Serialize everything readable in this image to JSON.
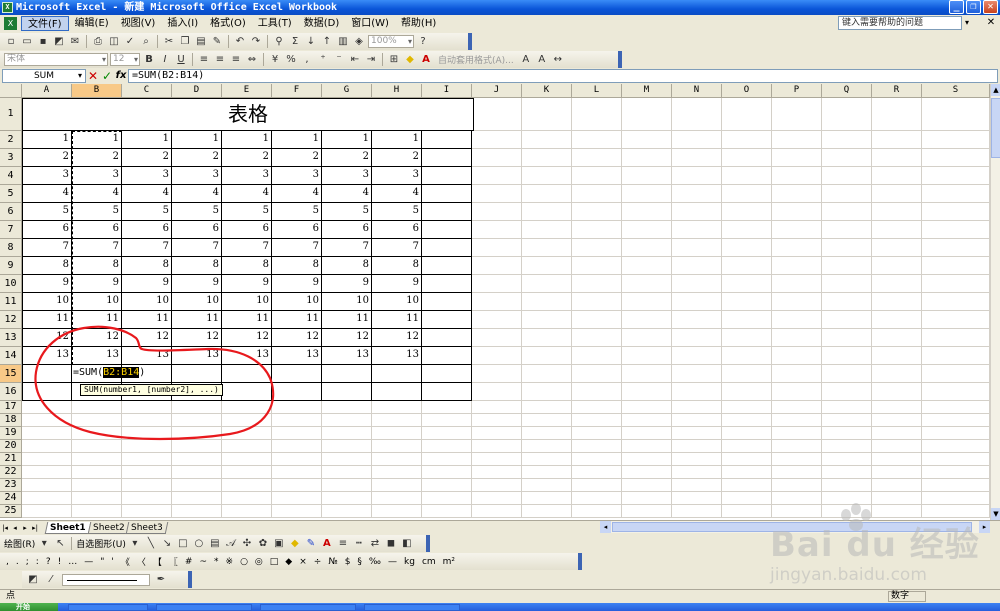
{
  "window": {
    "title": "Microsoft Excel - 新建 Microsoft Office Excel Workbook",
    "minimize": "_",
    "restore": "❐",
    "close": "✕"
  },
  "menu": {
    "items": [
      "文件(F)",
      "编辑(E)",
      "视图(V)",
      "插入(I)",
      "格式(O)",
      "工具(T)",
      "数据(D)",
      "窗口(W)",
      "帮助(H)"
    ],
    "help_placeholder": "键入需要帮助的问题"
  },
  "toolbar": {
    "zoom": "100%",
    "font_name": "宋体",
    "font_size": "12",
    "conditional_format": "自动套用格式(A)..."
  },
  "formula_bar": {
    "name_box": "SUM",
    "formula": "=SUM(B2:B14)"
  },
  "sheet": {
    "columns": [
      "A",
      "B",
      "C",
      "D",
      "E",
      "F",
      "G",
      "H",
      "I",
      "J",
      "K",
      "L",
      "M",
      "N",
      "O",
      "P",
      "Q",
      "R",
      "S"
    ],
    "rows": [
      "1",
      "2",
      "3",
      "4",
      "5",
      "6",
      "7",
      "8",
      "9",
      "10",
      "11",
      "12",
      "13",
      "14",
      "15",
      "16",
      "17",
      "18",
      "19",
      "20",
      "21",
      "22",
      "23",
      "24",
      "25"
    ],
    "title": "表格",
    "values": [
      1,
      2,
      3,
      4,
      5,
      6,
      7,
      8,
      9,
      10,
      11,
      12,
      13
    ],
    "edit_prefix": "=SUM(",
    "edit_ref": "B2:B14",
    "edit_suffix": ")",
    "tooltip": "SUM(number1, [number2], ...)",
    "selected_column": "B",
    "selected_row": "15"
  },
  "sheet_tabs": [
    "Sheet1",
    "Sheet2",
    "Sheet3"
  ],
  "drawing_toolbar": {
    "draw_label": "绘图(R)",
    "autoshapes_label": "自选图形(U)"
  },
  "symbols": [
    ",",
    ".",
    ";",
    ":",
    "?",
    "!",
    "…",
    "—",
    "\"",
    "'",
    "《",
    "〈",
    "【",
    "〖",
    "#",
    "~",
    "*",
    "※",
    "○",
    "◎",
    "□",
    "◆",
    "×",
    "÷",
    "№",
    "$",
    "§",
    "‰",
    "—",
    "kg",
    "cm",
    "m²"
  ],
  "status": {
    "mode": "点",
    "num": "数字"
  },
  "taskbar": {
    "start": "开始"
  },
  "watermark": {
    "brand": "Bai du 经验",
    "url": "jingyan.baidu.com"
  },
  "colors": {
    "annotation": "#e8191d",
    "selection_header": "#f8c987",
    "titlebar": "#0a55d8"
  }
}
